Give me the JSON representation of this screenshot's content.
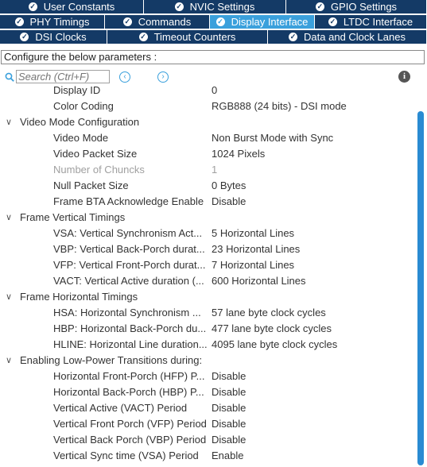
{
  "tabs": {
    "row1": [
      "User Constants",
      "NVIC Settings",
      "GPIO Settings"
    ],
    "row2": [
      "PHY Timings",
      "Commands",
      "Display Interface",
      "LTDC Interface"
    ],
    "row3": [
      "DSI Clocks",
      "Timeout Counters",
      "Data and Clock Lanes"
    ],
    "active": "Display Interface"
  },
  "config_label": "Configure the below parameters :",
  "search": {
    "placeholder": "Search (Ctrl+F)"
  },
  "icons": {
    "check": "check-circle-icon",
    "search": "search-icon",
    "prev": "arrow-left-icon",
    "next": "arrow-right-icon",
    "info": "info-icon"
  },
  "colors": {
    "tab_bg": "#143a66",
    "tab_active": "#3aa0dc",
    "scrollbar": "#2a8bd2"
  },
  "tree": [
    {
      "label": "Display ID",
      "value": "0"
    },
    {
      "label": "Color Coding",
      "value": "RGB888 (24 bits) - DSI mode"
    },
    {
      "section": "Video Mode Configuration"
    },
    {
      "label": "Video Mode",
      "value": "Non Burst Mode with Sync"
    },
    {
      "label": "Video Packet Size",
      "value": "1024 Pixels"
    },
    {
      "label": "Number of Chuncks",
      "value": "1",
      "disabled": true
    },
    {
      "label": "Null Packet Size",
      "value": "0 Bytes"
    },
    {
      "label": "Frame BTA Acknowledge Enable",
      "value": "Disable"
    },
    {
      "section": "Frame Vertical Timings"
    },
    {
      "label": "VSA: Vertical Synchronism Act...",
      "value": "5 Horizontal Lines"
    },
    {
      "label": "VBP: Vertical Back-Porch durat...",
      "value": "23 Horizontal Lines"
    },
    {
      "label": "VFP: Vertical Front-Porch durat...",
      "value": "7 Horizontal Lines"
    },
    {
      "label": "VACT: Vertical Active duration (...",
      "value": "600 Horizontal Lines"
    },
    {
      "section": "Frame Horizontal Timings"
    },
    {
      "label": "HSA: Horizontal Synchronism ...",
      "value": "57 lane byte clock cycles"
    },
    {
      "label": "HBP: Horizontal Back-Porch du...",
      "value": "477 lane byte clock cycles"
    },
    {
      "label": "HLINE: Horizontal Line duration...",
      "value": "4095 lane byte clock cycles"
    },
    {
      "section": "Enabling Low-Power Transitions during:"
    },
    {
      "label": "Horizontal Front-Porch (HFP) P...",
      "value": "Disable"
    },
    {
      "label": "Horizontal Back-Porch (HBP) P...",
      "value": "Disable"
    },
    {
      "label": "Vertical Active (VACT) Period",
      "value": "Disable"
    },
    {
      "label": "Vertical Front Porch (VFP) Period",
      "value": "Disable"
    },
    {
      "label": "Vertical Back Porch (VBP) Period",
      "value": "Disable"
    },
    {
      "label": "Vertical Sync time (VSA) Period",
      "value": "Enable"
    }
  ]
}
